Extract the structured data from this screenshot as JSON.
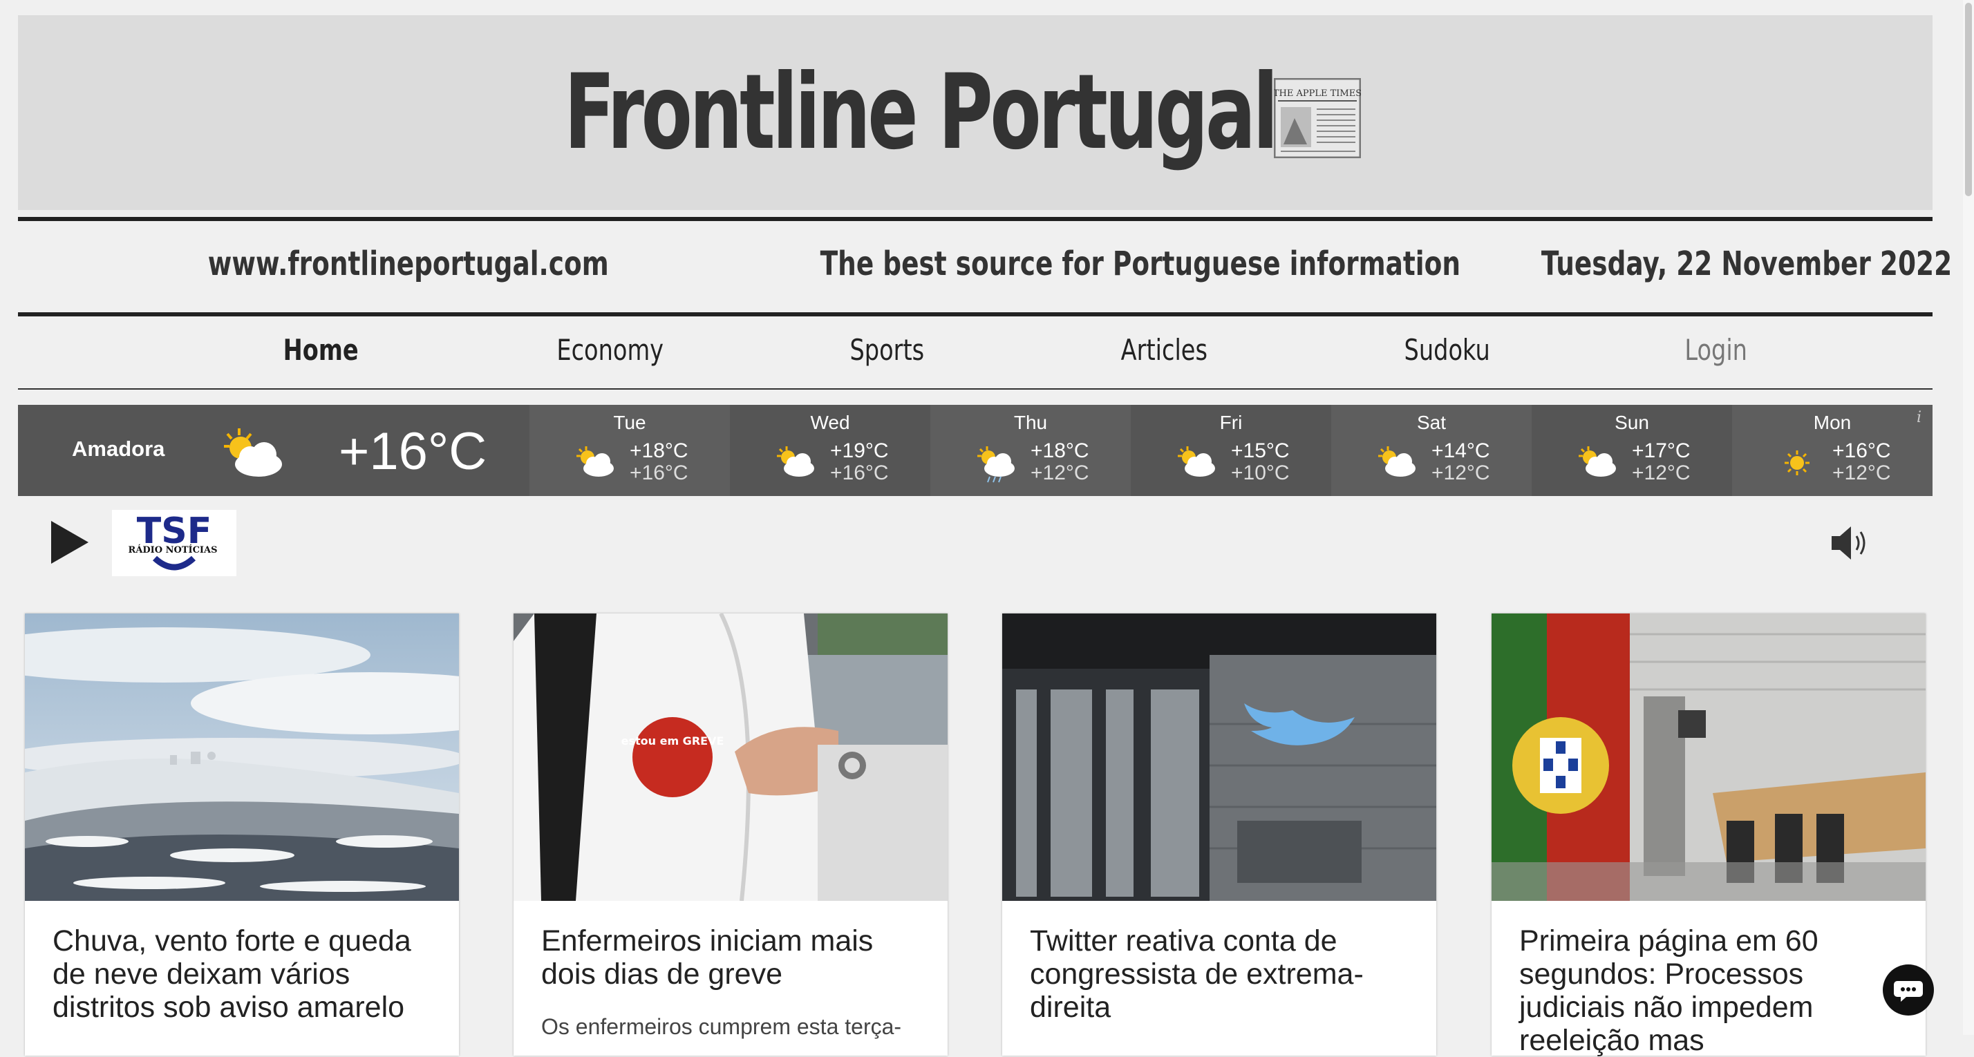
{
  "header": {
    "title": "Frontline Portugal",
    "newspaper_icon": "newspaper-icon",
    "newspaper_icon_text": "THE APPLE TIMES",
    "website": "www.frontlineportugal.com",
    "tagline": "The best source for Portuguese information",
    "date": "Tuesday, 22 November 2022"
  },
  "nav": {
    "items": [
      {
        "label": "Home",
        "active": true
      },
      {
        "label": "Economy"
      },
      {
        "label": "Sports"
      },
      {
        "label": "Articles"
      },
      {
        "label": "Sudoku"
      },
      {
        "label": "Login"
      }
    ]
  },
  "weather": {
    "city": "Amadora",
    "current_temp": "+16°C",
    "current_icon": "partly-cloudy-icon",
    "info_symbol": "i",
    "days": [
      {
        "day": "Tue",
        "high": "+18°C",
        "low": "+16°C",
        "icon": "partly-cloudy-icon"
      },
      {
        "day": "Wed",
        "high": "+19°C",
        "low": "+16°C",
        "icon": "partly-cloudy-icon"
      },
      {
        "day": "Thu",
        "high": "+18°C",
        "low": "+12°C",
        "icon": "rain-cloud-icon"
      },
      {
        "day": "Fri",
        "high": "+15°C",
        "low": "+10°C",
        "icon": "partly-cloudy-icon"
      },
      {
        "day": "Sat",
        "high": "+14°C",
        "low": "+12°C",
        "icon": "partly-cloudy-icon"
      },
      {
        "day": "Sun",
        "high": "+17°C",
        "low": "+12°C",
        "icon": "partly-cloudy-icon"
      },
      {
        "day": "Mon",
        "high": "+16°C",
        "low": "+12°C",
        "icon": "sun-icon"
      }
    ]
  },
  "radio": {
    "station_logo_text": "TSF",
    "station_sub": "RÁDIO NOTÍCIAS",
    "play_icon": "play-icon",
    "volume_icon": "speaker-icon"
  },
  "articles": [
    {
      "title": "Chuva, vento forte e queda de neve deixam vários distritos sob aviso amarelo",
      "excerpt": "",
      "image": "snowy-landscape"
    },
    {
      "title": "Enfermeiros iniciam mais dois dias de greve",
      "excerpt": "Os enfermeiros cumprem esta terça-",
      "image": "nurse-strike-badge",
      "badge_text": "estou em GREVE"
    },
    {
      "title": "Twitter reativa conta de congressista de extrema-direita",
      "excerpt": "",
      "image": "twitter-building"
    },
    {
      "title": "Primeira página em 60 segundos: Processos judiciais não impedem reeleição mas",
      "excerpt": "",
      "image": "courtroom-flag"
    }
  ],
  "colors": {
    "page_bg": "#f0f0f0",
    "masthead_bg": "#dcdcdc",
    "weather_bg": "#555555",
    "text_dark": "#222222"
  }
}
